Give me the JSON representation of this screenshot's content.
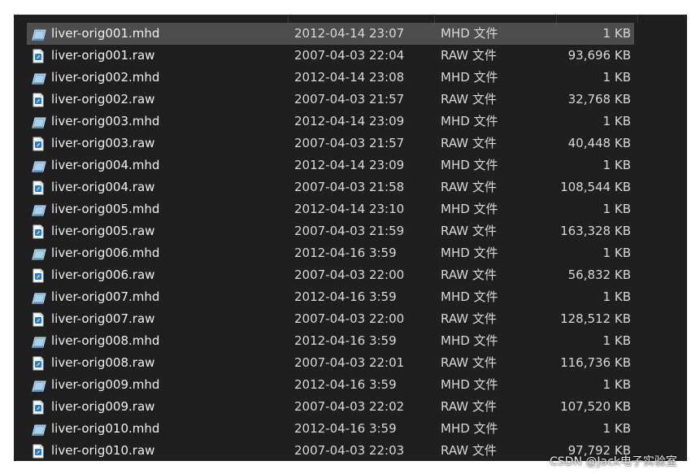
{
  "files": [
    {
      "name": "liver-orig001.mhd",
      "date": "2012-04-14 23:07",
      "type": "MHD 文件",
      "size": "1 KB",
      "icon": "mhd-file-icon",
      "selected": true
    },
    {
      "name": "liver-orig001.raw",
      "date": "2007-04-03 22:04",
      "type": "RAW 文件",
      "size": "93,696 KB",
      "icon": "raw-file-icon"
    },
    {
      "name": "liver-orig002.mhd",
      "date": "2012-04-14 23:08",
      "type": "MHD 文件",
      "size": "1 KB",
      "icon": "mhd-file-icon"
    },
    {
      "name": "liver-orig002.raw",
      "date": "2007-04-03 21:57",
      "type": "RAW 文件",
      "size": "32,768 KB",
      "icon": "raw-file-icon"
    },
    {
      "name": "liver-orig003.mhd",
      "date": "2012-04-14 23:09",
      "type": "MHD 文件",
      "size": "1 KB",
      "icon": "mhd-file-icon"
    },
    {
      "name": "liver-orig003.raw",
      "date": "2007-04-03 21:57",
      "type": "RAW 文件",
      "size": "40,448 KB",
      "icon": "raw-file-icon"
    },
    {
      "name": "liver-orig004.mhd",
      "date": "2012-04-14 23:09",
      "type": "MHD 文件",
      "size": "1 KB",
      "icon": "mhd-file-icon"
    },
    {
      "name": "liver-orig004.raw",
      "date": "2007-04-03 21:58",
      "type": "RAW 文件",
      "size": "108,544 KB",
      "icon": "raw-file-icon"
    },
    {
      "name": "liver-orig005.mhd",
      "date": "2012-04-14 23:10",
      "type": "MHD 文件",
      "size": "1 KB",
      "icon": "mhd-file-icon"
    },
    {
      "name": "liver-orig005.raw",
      "date": "2007-04-03 21:59",
      "type": "RAW 文件",
      "size": "163,328 KB",
      "icon": "raw-file-icon"
    },
    {
      "name": "liver-orig006.mhd",
      "date": "2012-04-16 3:59",
      "type": "MHD 文件",
      "size": "1 KB",
      "icon": "mhd-file-icon"
    },
    {
      "name": "liver-orig006.raw",
      "date": "2007-04-03 22:00",
      "type": "RAW 文件",
      "size": "56,832 KB",
      "icon": "raw-file-icon"
    },
    {
      "name": "liver-orig007.mhd",
      "date": "2012-04-16 3:59",
      "type": "MHD 文件",
      "size": "1 KB",
      "icon": "mhd-file-icon"
    },
    {
      "name": "liver-orig007.raw",
      "date": "2007-04-03 22:00",
      "type": "RAW 文件",
      "size": "128,512 KB",
      "icon": "raw-file-icon"
    },
    {
      "name": "liver-orig008.mhd",
      "date": "2012-04-16 3:59",
      "type": "MHD 文件",
      "size": "1 KB",
      "icon": "mhd-file-icon"
    },
    {
      "name": "liver-orig008.raw",
      "date": "2007-04-03 22:01",
      "type": "RAW 文件",
      "size": "116,736 KB",
      "icon": "raw-file-icon"
    },
    {
      "name": "liver-orig009.mhd",
      "date": "2012-04-16 3:59",
      "type": "MHD 文件",
      "size": "1 KB",
      "icon": "mhd-file-icon"
    },
    {
      "name": "liver-orig009.raw",
      "date": "2007-04-03 22:02",
      "type": "RAW 文件",
      "size": "107,520 KB",
      "icon": "raw-file-icon"
    },
    {
      "name": "liver-orig010.mhd",
      "date": "2012-04-16 3:59",
      "type": "MHD 文件",
      "size": "1 KB",
      "icon": "mhd-file-icon"
    },
    {
      "name": "liver-orig010.raw",
      "date": "2007-04-03 22:03",
      "type": "RAW 文件",
      "size": "97,792 KB",
      "icon": "raw-file-icon"
    }
  ],
  "watermark": "CSDN @Jack电子实验室",
  "colors": {
    "background": "#1f1f1f",
    "selected_row": "#4d4d4d",
    "text": "#f0f0f0"
  }
}
